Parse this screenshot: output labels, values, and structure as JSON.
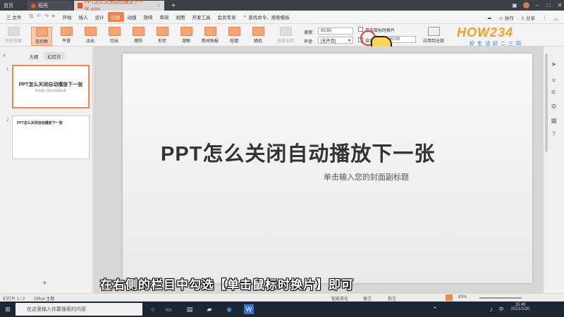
{
  "titlebar": {
    "tabs": [
      {
        "label": "首页"
      },
      {
        "label": "稻壳"
      },
      {
        "label": "PPT怎么关闭自动播放下一张.pptx"
      }
    ],
    "add": "+"
  },
  "menubar": {
    "file": "三 文件",
    "items": [
      "开始",
      "插入",
      "设计",
      "切换",
      "动画",
      "放映",
      "审阅",
      "视图",
      "开发工具",
      "会员专享"
    ],
    "active": "切换",
    "search": "查找命令、搜索模板",
    "collab": "协作",
    "share": "分享"
  },
  "ribbon": {
    "preview": "预览效果",
    "transitions": [
      "无切换",
      "平滑",
      "淡出",
      "切出",
      "擦除",
      "形状",
      "溶解",
      "新闻快报",
      "轮辐",
      "随机"
    ],
    "effect_options": "效果选项",
    "speed_label": "速度:",
    "speed_value": "00.50",
    "sound_label": "声音:",
    "sound_value": "[无声音]",
    "click_advance_label": "单击鼠标时换片",
    "auto_label": "自动换片:",
    "auto_value": "00:00",
    "apply_all": "应用到全部"
  },
  "logo": {
    "text": "HOW234",
    "sub": "好生活好二三四"
  },
  "leftpanel": {
    "tab_outline": "大纲",
    "tab_slides": "幻灯片",
    "slides": [
      {
        "num": "1",
        "title": "PPT怎么关闭自动播放下一张",
        "subtitle": "单击输入您的封面副标题"
      },
      {
        "num": "2",
        "title": "PPT怎么关闭自动播放下一张"
      }
    ],
    "add": "+"
  },
  "slide": {
    "title": "PPT怎么关闭自动播放下一张",
    "subtitle": "单击输入您的封面副标题"
  },
  "statusbar": {
    "slide_info": "幻灯片 1 / 2",
    "theme": "Office 主题",
    "smart": "智能美化",
    "notes": "备注",
    "comments": "批注",
    "zoom": "83%"
  },
  "caption": "在右侧的栏目中勾选【单击鼠标时换片】即可",
  "taskbar": {
    "search_placeholder": "在这里输入你要搜索的内容",
    "time": "15:49",
    "date": "2021/1/20",
    "lang": "中"
  }
}
